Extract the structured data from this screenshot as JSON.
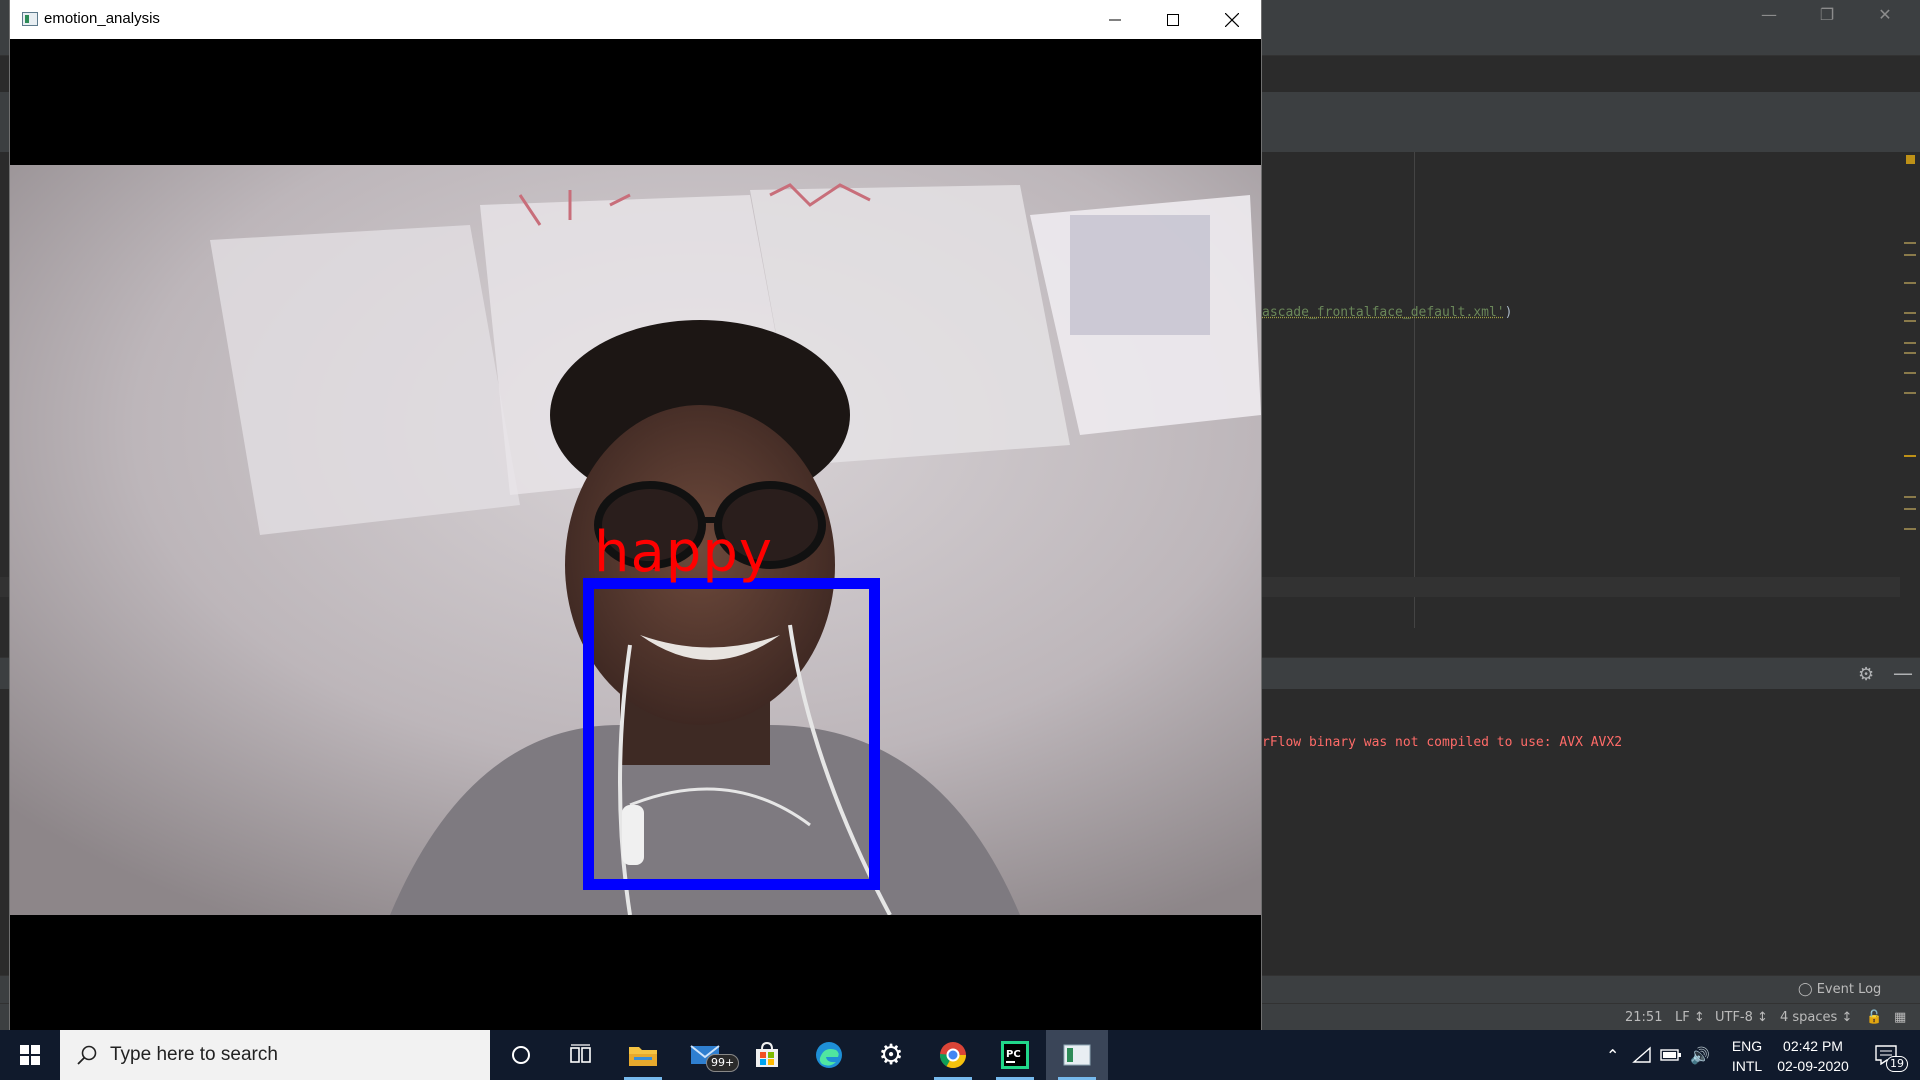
{
  "window": {
    "title": "emotion_analysis",
    "detected_emotion": "happy"
  },
  "ide": {
    "code_fragment_string": "ascade_frontalface_default.xml'",
    "code_fragment_close": ")",
    "console_line": "rFlow binary was not compiled to use: AVX AVX2",
    "event_log_label": "Event Log",
    "status": {
      "position": "21:51",
      "line_separator": "LF",
      "encoding": "UTF-8",
      "indent": "4 spaces"
    }
  },
  "taskbar": {
    "search_placeholder": "Type here to search",
    "mail_badge": "99+",
    "language_top": "ENG",
    "language_bottom": "INTL",
    "time": "02:42 PM",
    "date": "02-09-2020",
    "notification_count": "19"
  },
  "colors": {
    "bbox": "#0000ff",
    "label": "#ff0000",
    "ide_bg": "#2b2b2b",
    "console_error": "#ff6b68",
    "taskbar": "#101a2c"
  }
}
